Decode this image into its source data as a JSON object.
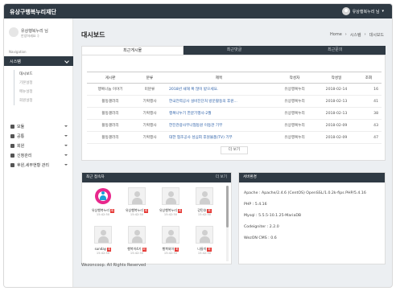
{
  "app": {
    "brand": "유상구행복누리재단"
  },
  "topbar": {
    "user": "유상행복누리 님"
  },
  "profile": {
    "name": "유상행복누리 님",
    "subtitle": "안녕하세요 :)"
  },
  "sidebar": {
    "section_label": "Navigation",
    "system": "시스템",
    "system_sub": [
      "대시보드",
      "기본설정",
      "메뉴설정",
      "회원설정"
    ],
    "menus": [
      "모듈",
      "공통",
      "회원",
      "신청관리",
      "후원,세부현황 관리"
    ]
  },
  "page": {
    "title": "대시보드"
  },
  "breadcrumb": [
    "Home",
    "시스템",
    "대시보드"
  ],
  "tabs": [
    "최근게시물",
    "최근댓글",
    "최근문의"
  ],
  "board": {
    "headers": [
      "게시판",
      "분류",
      "제목",
      "작성자",
      "작성일",
      "조회"
    ],
    "rows": [
      {
        "board": "행복나눔 이야기",
        "category": "미분류",
        "title": "2018년 새해 복 많이 받으세요.",
        "author": "유상행복누리",
        "date": "2018-02-14",
        "views": "16"
      },
      {
        "board": "활동갤러리",
        "category": "기획행사",
        "title": "한국전력공사 설비진단처 방문활동의 후원...",
        "author": "유상행복누리",
        "date": "2018-02-13",
        "views": "41"
      },
      {
        "board": "활동갤러리",
        "category": "기획행사",
        "title": "행복나누기 한끝기행사-2월",
        "author": "유상행복누리",
        "date": "2018-02-13",
        "views": "38"
      },
      {
        "board": "활동갤러리",
        "category": "기획행사",
        "title": "한진관광사무나협동원 이동관 기부",
        "author": "유상행복누리",
        "date": "2018-02-09",
        "views": "43"
      },
      {
        "board": "활동갤러리",
        "category": "기획행사",
        "title": "대한 협조공사 성심회 후원물품(TV) 기부",
        "author": "유상행복누리",
        "date": "2018-02-09",
        "views": "47"
      }
    ],
    "more_label": "더 보기"
  },
  "visitors": {
    "title": "최근 접속자",
    "more": "더 보기",
    "badge": "회",
    "items": [
      {
        "name": "유상행복누리",
        "time": "15:42:50"
      },
      {
        "name": "유상행복누리",
        "time": "15:42:50"
      },
      {
        "name": "유상행복누리",
        "time": "15:42:50"
      },
      {
        "name": "강민호",
        "time": "15:42:50"
      },
      {
        "name": "sunday",
        "time": "15:42:50"
      },
      {
        "name": "행복이4기",
        "time": "15:42:50"
      },
      {
        "name": "행복외아",
        "time": "15:42:50"
      },
      {
        "name": "나들이",
        "time": "15:42:50"
      }
    ]
  },
  "server": {
    "title": "서버환경",
    "lines": [
      "Apache : Apache/2.4.6 (CentOS) OpenSSL/1.0.2k-fips PHP/5.4.16",
      "PHP : 5.4.16",
      "Mysql : 5.5.5-10.1.25-MariaDB",
      "Codeigniter : 2.2.0",
      "WezON CMS : 0.6"
    ]
  },
  "footer": {
    "text": "Wezoncoop. All Rights Reserved"
  },
  "colors": {
    "topbar": "#2f3a44",
    "badge": "#e53935",
    "link": "#2b5fa8"
  }
}
